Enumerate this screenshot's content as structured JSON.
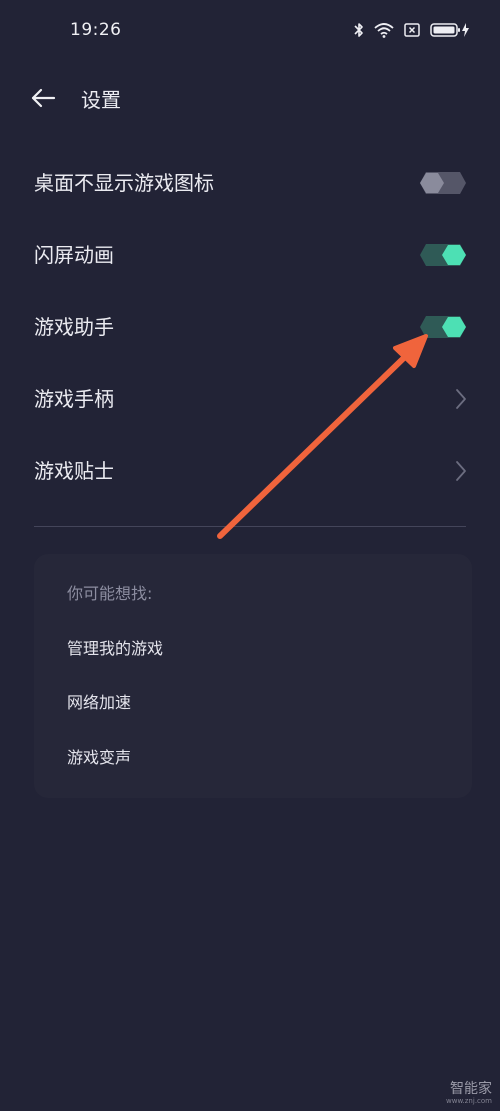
{
  "status_bar": {
    "time": "19:26",
    "icons": [
      "bluetooth-icon",
      "wifi-icon",
      "sim-off-icon",
      "battery-charging-icon"
    ]
  },
  "header": {
    "back_icon": "arrow-left-icon",
    "title": "设置"
  },
  "settings": [
    {
      "label": "桌面不显示游戏图标",
      "control": "toggle",
      "on": false
    },
    {
      "label": "闪屏动画",
      "control": "toggle",
      "on": true
    },
    {
      "label": "游戏助手",
      "control": "toggle",
      "on": true
    },
    {
      "label": "游戏手柄",
      "control": "chevron"
    },
    {
      "label": "游戏贴士",
      "control": "chevron"
    }
  ],
  "suggestions": {
    "title": "你可能想找:",
    "items": [
      "管理我的游戏",
      "网络加速",
      "游戏变声"
    ]
  },
  "watermark": {
    "main": "智能家",
    "sub": "www.znj.com"
  },
  "colors": {
    "background": "#222336",
    "toggle_on": "#4de0b4",
    "toggle_off": "#6a6b7c",
    "annotation_arrow": "#f0643c"
  }
}
